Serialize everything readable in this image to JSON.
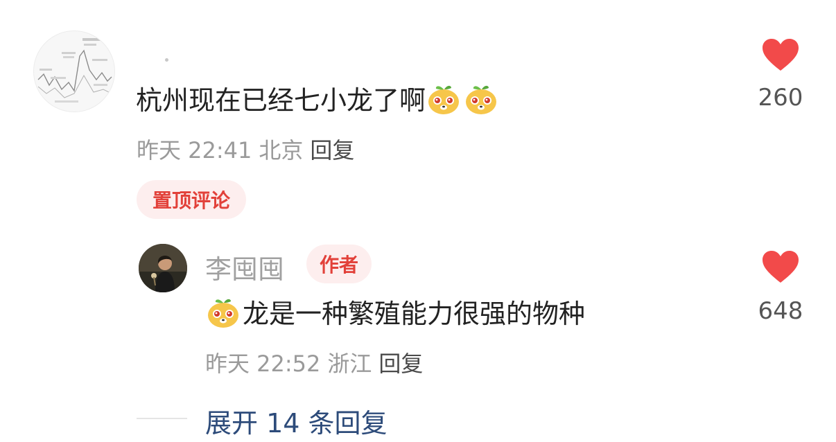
{
  "comment": {
    "text": "杭州现在已经七小龙了啊",
    "time": "昨天 22:41",
    "location": "北京",
    "reply_label": "回复",
    "pin_label": "置顶评论",
    "likes": "260"
  },
  "reply": {
    "author": "李囤囤",
    "author_badge": "作者",
    "text": "龙是一种繁殖能力很强的物种",
    "time": "昨天 22:52",
    "location": "浙江",
    "reply_label": "回复",
    "likes": "648"
  },
  "expand_label": "展开 14 条回复",
  "colors": {
    "heart": "#f24a4a",
    "badge_text": "#e2413a",
    "badge_bg": "#fdeeee",
    "expand_link": "#2d4b7a"
  },
  "icons": [
    "heart-icon",
    "emoji-sticker-icon"
  ]
}
